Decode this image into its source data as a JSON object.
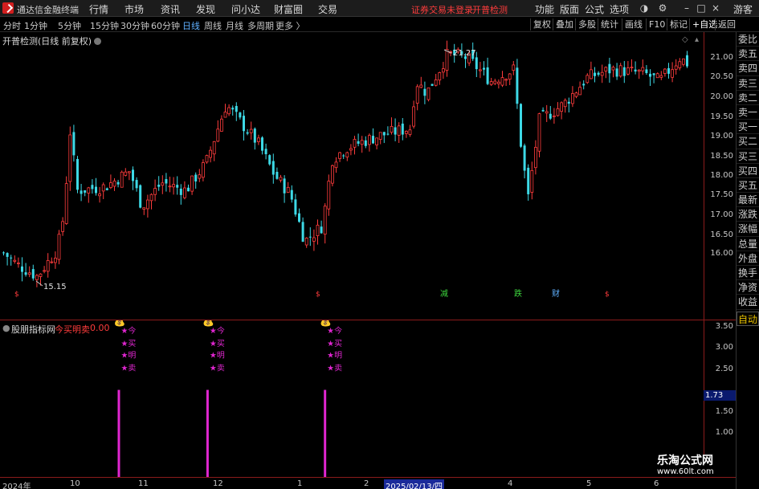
{
  "menubar": {
    "app_title": "通达信金融终端",
    "menus": [
      "行情",
      "市场",
      "资讯",
      "发现",
      "问小达",
      "财富圈",
      "交易"
    ],
    "notice_left": "证券交易未登录",
    "notice_right": "开普检测",
    "right_menus": [
      "功能",
      "版面",
      "公式",
      "选项"
    ],
    "guest": "游客"
  },
  "periodbar": {
    "periods": [
      "分时",
      "1分钟",
      "5分钟",
      "15分钟",
      "30分钟",
      "60分钟",
      "日线",
      "周线",
      "月线",
      "多周期",
      "更多 〉"
    ],
    "active": "日线",
    "tools": [
      "复权",
      "叠加",
      "多股",
      "统计",
      "画线",
      "F10",
      "标记",
      "+自选",
      "返回"
    ]
  },
  "main": {
    "title": "开普检测(日线 前复权)",
    "price_ticks": [
      "21.00",
      "20.50",
      "20.00",
      "19.50",
      "19.00",
      "18.50",
      "18.00",
      "17.50",
      "17.00",
      "16.50",
      "16.00"
    ],
    "high_label": "21.27",
    "low_label": "15.15",
    "event_markers": [
      "减",
      "跌",
      "财"
    ],
    "colors": {
      "up": "#ff3c3c",
      "down": "#3dd9e6",
      "axis": "#8b1b1b"
    }
  },
  "sidetabs": [
    "委比",
    "卖五",
    "卖四",
    "卖三",
    "卖二",
    "卖一",
    "买一",
    "买二",
    "买三",
    "买四",
    "买五",
    "最新",
    "涨跌",
    "涨幅",
    "总量",
    "外盘",
    "换手",
    "净资",
    "收益",
    "自动"
  ],
  "indicator": {
    "name": "股朋指标网",
    "series_label": "今买明卖",
    "series_value": "0.00",
    "ticks": [
      "3.50",
      "3.00",
      "2.50",
      "2.00",
      "1.50",
      "1.00"
    ],
    "current_value": "1.73",
    "signal_texts": [
      "★今",
      "★买",
      "★明",
      "★卖"
    ],
    "money_icon": "money-bag-icon",
    "bar_color": "#e026d0"
  },
  "date_axis": {
    "labels": [
      "2024年",
      "10",
      "11",
      "12",
      "1",
      "2",
      "2025/02/13/四",
      "4",
      "5",
      "6"
    ]
  },
  "watermark": {
    "line1": "乐淘公式网",
    "line2": "www.60lt.com"
  }
}
